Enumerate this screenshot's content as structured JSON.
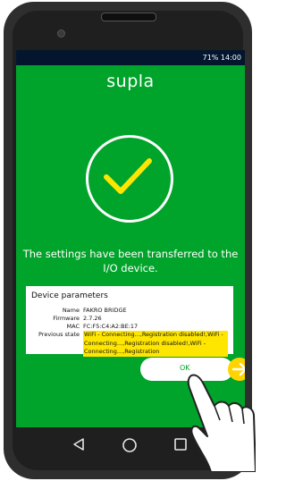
{
  "status": {
    "text": "71% 14:00"
  },
  "app": {
    "title": "supla"
  },
  "message": {
    "text": "The settings have been transferred to the I/O device."
  },
  "panel": {
    "title": "Device parameters",
    "rows": [
      {
        "label": "Name",
        "value": "FAKRO BRIDGE"
      },
      {
        "label": "Firmware",
        "value": "2.7.26"
      },
      {
        "label": "MAC",
        "value": "FC:F5:C4:A2:BE:17"
      },
      {
        "label": "Previous state",
        "value": "WiFi - Connecting...,Registration disabled!,WiFi - Connecting...,Registration disabled!,WiFi - Connecting...,Registration"
      }
    ]
  },
  "ok_button": {
    "label": "OK"
  },
  "colors": {
    "accent": "#00a42a",
    "highlight": "#ffe600",
    "arrow": "#ffd400",
    "statusbar": "#04162e"
  }
}
